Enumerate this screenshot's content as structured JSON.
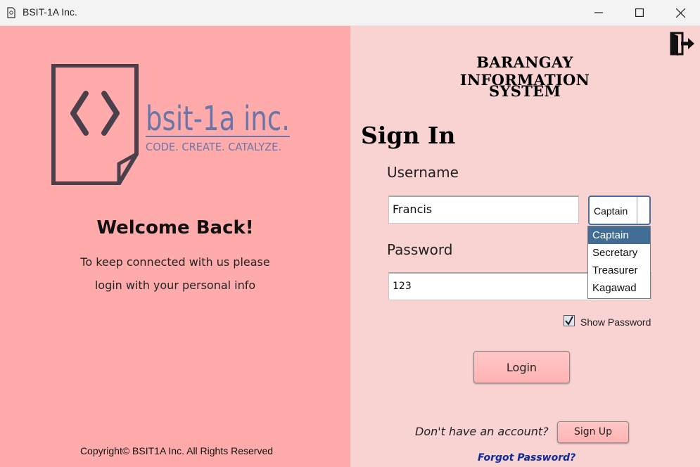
{
  "window": {
    "title": "BSIT-1A Inc.",
    "controls": [
      "minimize",
      "maximize",
      "close"
    ]
  },
  "left_panel": {
    "logo": {
      "brand_text": "bsit-1a inc.",
      "tagline": "CODE. CREATE. CATALYZE.",
      "icon": "code-document-icon"
    },
    "welcome_title": "Welcome Back!",
    "welcome_line1": "To keep connected with us please",
    "welcome_line2": "login with your personal info",
    "copyright": "Copyright© BSIT1A Inc. All Rights Reserved"
  },
  "right_panel": {
    "exit_icon": "exit-door-icon",
    "system_title_line1": "BARANGAY INFORMATION",
    "system_title_line2": "SYSTEM",
    "heading": "Sign In",
    "username_label": "Username",
    "username_value": "Francis",
    "role_select": {
      "selected": "Captain",
      "options": [
        "Captain",
        "Secretary",
        "Treasurer",
        "Kagawad"
      ]
    },
    "password_label": "Password",
    "password_value": "123",
    "show_password": {
      "label": "Show Password",
      "checked": true
    },
    "login_label": "Login",
    "no_account_text": "Don't have an account?",
    "signup_label": "Sign Up",
    "forgot_label": "Forgot Password?"
  },
  "colors": {
    "left_bg": "#ffabab",
    "right_bg": "#f9d3d2",
    "button_bg": "#ffbcbc",
    "selected_option": "#416c94",
    "link": "#0b2b9a",
    "logo_dark": "#4a3f4a",
    "logo_accent": "#6b76a8"
  }
}
